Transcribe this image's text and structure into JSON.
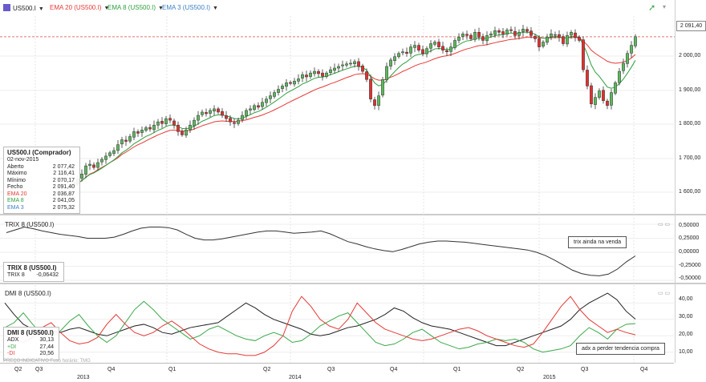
{
  "toolbar": {
    "symbol": "US500.I",
    "ema20": "EMA 20 (US500.I)",
    "ema8": "EMA 8 (US500.I)",
    "ema3": "EMA 3 (US500.I)"
  },
  "colors": {
    "bull": "#5cb85c",
    "bear": "#e03030",
    "ema20": "#e53935",
    "ema8": "#2e9e3e",
    "trix": "#333333",
    "adx": "#222222",
    "plus_di": "#3aa84a",
    "minus_di": "#e53935"
  },
  "price_panel": {
    "current_price": "2 091,40",
    "y_labels": [
      "2 000,00",
      "1 900,00",
      "1 800,00",
      "1 700,00",
      "1 600,00"
    ],
    "legend": {
      "title": "US500.I (Comprador)",
      "date": "02-nov-2015",
      "rows": [
        {
          "k": "Aberto",
          "v": "2 077,42"
        },
        {
          "k": "Máximo",
          "v": "2 116,41"
        },
        {
          "k": "Mínimo",
          "v": "2 070,17"
        },
        {
          "k": "Fecho",
          "v": "2 091,40"
        },
        {
          "k": "EMA 20",
          "v": "2 036,87"
        },
        {
          "k": "EMA 8",
          "v": "2 041,05"
        },
        {
          "k": "EMA 3",
          "v": "2 075,32"
        }
      ]
    }
  },
  "trix_panel": {
    "title": "TRIX 8 (US500.I)",
    "y_labels": [
      "0,50000",
      "0,25000",
      "0,00000",
      "-0,25000",
      "-0,50000"
    ],
    "legend_title": "TRIX 8 (US500.I)",
    "legend_key": "TRIX 8",
    "legend_value": "-0,06432",
    "note": "trix ainda na venda"
  },
  "dmi_panel": {
    "title": "DMI 8 (US500.I)",
    "y_labels": [
      "40,00",
      "30,00",
      "20,00",
      "10,00"
    ],
    "legend_title": "DMI 8 (US500.I)",
    "rows": [
      {
        "k": "ADX",
        "v": "30,13"
      },
      {
        "k": "+DI",
        "v": "27,44"
      },
      {
        "k": "-DI",
        "v": "20,56"
      }
    ],
    "note": "adx a perder tendencia compra"
  },
  "watermark": "PREÇO INDICATIVO   Fuso horário: TMG",
  "x_axis": {
    "quarters": [
      "Q2",
      "Q3",
      "Q4",
      "Q1",
      "Q2",
      "Q3",
      "Q4",
      "Q1",
      "Q2",
      "Q3",
      "Q4"
    ],
    "years": [
      "2013",
      "2014",
      "2015"
    ]
  },
  "chart_data": [
    {
      "type": "candlestick",
      "title": "US500.I",
      "ylim": [
        1560,
        2150
      ],
      "closes": [
        1640,
        1655,
        1670,
        1695,
        1700,
        1690,
        1705,
        1715,
        1725,
        1735,
        1742,
        1760,
        1775,
        1770,
        1785,
        1800,
        1795,
        1805,
        1812,
        1808,
        1820,
        1830,
        1825,
        1840,
        1835,
        1820,
        1800,
        1790,
        1805,
        1820,
        1835,
        1850,
        1860,
        1855,
        1865,
        1870,
        1860,
        1850,
        1840,
        1830,
        1825,
        1835,
        1850,
        1865,
        1870,
        1880,
        1875,
        1890,
        1900,
        1910,
        1920,
        1930,
        1940,
        1950,
        1948,
        1955,
        1962,
        1975,
        1968,
        1980,
        1985,
        1978,
        1970,
        1980,
        1990,
        1995,
        2000,
        2005,
        2008,
        2010,
        2015,
        2000,
        1985,
        1960,
        1900,
        1880,
        1910,
        1960,
        2000,
        2020,
        2030,
        2040,
        2045,
        2040,
        2060,
        2065,
        2050,
        2040,
        2055,
        2070,
        2075,
        2060,
        2050,
        2045,
        2060,
        2080,
        2090,
        2100,
        2095,
        2085,
        2105,
        2090,
        2080,
        2095,
        2100,
        2110,
        2105,
        2100,
        2112,
        2110,
        2095,
        2105,
        2115,
        2108,
        2095,
        2085,
        2060,
        2075,
        2090,
        2100,
        2098,
        2090,
        2070,
        2095,
        2105,
        2090,
        2080,
        1990,
        1940,
        1885,
        1905,
        1925,
        1895,
        1880,
        1920,
        1950,
        1985,
        2010,
        2040,
        2065,
        2091.4
      ],
      "ema20": [
        1630,
        1640,
        1650,
        1660,
        1670,
        1675,
        1683,
        1690,
        1697,
        1705,
        1712,
        1720,
        1730,
        1737,
        1745,
        1753,
        1760,
        1765,
        1772,
        1778,
        1784,
        1790,
        1795,
        1800,
        1804,
        1805,
        1803,
        1801,
        1802,
        1804,
        1808,
        1813,
        1818,
        1822,
        1826,
        1830,
        1832,
        1833,
        1832,
        1832,
        1831,
        1832,
        1834,
        1836,
        1840,
        1844,
        1847,
        1851,
        1856,
        1861,
        1867,
        1873,
        1879,
        1886,
        1892,
        1898,
        1904,
        1910,
        1916,
        1922,
        1928,
        1933,
        1937,
        1942,
        1947,
        1951,
        1956,
        1961,
        1966,
        1970,
        1975,
        1977,
        1978,
        1976,
        1970,
        1962,
        1958,
        1958,
        1962,
        1967,
        1972,
        1978,
        1985,
        1990,
        1996,
        2002,
        2007,
        2010,
        2014,
        2019,
        2024,
        2028,
        2031,
        2033,
        2036,
        2040,
        2045,
        2050,
        2054,
        2057,
        2061,
        2064,
        2065,
        2067,
        2070,
        2073,
        2076,
        2078,
        2081,
        2083,
        2084,
        2086,
        2088,
        2090,
        2090,
        2090,
        2088,
        2087,
        2087,
        2088,
        2089,
        2089,
        2088,
        2088,
        2089,
        2089,
        2088,
        2078,
        2066,
        2050,
        2040,
        2032,
        2024,
        2016,
        2012,
        2010,
        2011,
        2014,
        2018,
        2026,
        2036.87
      ]
    },
    {
      "type": "line",
      "title": "TRIX 8 (US500.I)",
      "ylim": [
        -0.5,
        0.5
      ],
      "series": [
        {
          "name": "TRIX 8",
          "values": [
            0.35,
            0.4,
            0.45,
            0.42,
            0.38,
            0.35,
            0.32,
            0.3,
            0.28,
            0.25,
            0.25,
            0.25,
            0.27,
            0.32,
            0.38,
            0.43,
            0.45,
            0.45,
            0.44,
            0.4,
            0.32,
            0.25,
            0.22,
            0.22,
            0.24,
            0.27,
            0.3,
            0.33,
            0.36,
            0.38,
            0.38,
            0.36,
            0.34,
            0.35,
            0.36,
            0.38,
            0.33,
            0.26,
            0.19,
            0.15,
            0.1,
            0.06,
            0.03,
            0.01,
            0.05,
            0.1,
            0.15,
            0.18,
            0.2,
            0.2,
            0.19,
            0.18,
            0.16,
            0.14,
            0.12,
            0.1,
            0.08,
            0.06,
            0.04,
            0.0,
            -0.06,
            -0.14,
            -0.23,
            -0.32,
            -0.38,
            -0.41,
            -0.42,
            -0.39,
            -0.3,
            -0.17,
            -0.06432
          ]
        }
      ]
    },
    {
      "type": "line",
      "title": "DMI 8 (US500.I)",
      "ylim": [
        5,
        47
      ],
      "series": [
        {
          "name": "ADX",
          "values": [
            40,
            33,
            27,
            24,
            22,
            23,
            22,
            24,
            25,
            23,
            21,
            20,
            22,
            24,
            26,
            27,
            25,
            22,
            21,
            23,
            25,
            26,
            27,
            28,
            32,
            36,
            40,
            37,
            33,
            30,
            28,
            26,
            24,
            21,
            20,
            21,
            23,
            25,
            26,
            28,
            30,
            33,
            37,
            35,
            31,
            28,
            26,
            25,
            24,
            22,
            20,
            18,
            16,
            14,
            14,
            16,
            18,
            20,
            22,
            24,
            26,
            30,
            36,
            40,
            43,
            46,
            42,
            35,
            30.13
          ]
        },
        {
          "name": "+DI",
          "values": [
            25,
            28,
            34,
            27,
            21,
            19,
            23,
            29,
            33,
            26,
            20,
            16,
            20,
            28,
            36,
            41,
            36,
            30,
            26,
            22,
            18,
            20,
            24,
            26,
            23,
            20,
            18,
            17,
            20,
            22,
            20,
            16,
            17,
            21,
            26,
            29,
            32,
            34,
            28,
            22,
            16,
            14,
            15,
            18,
            22,
            24,
            20,
            16,
            14,
            12,
            13,
            15,
            16,
            18,
            17,
            18,
            16,
            12,
            10,
            11,
            12,
            14,
            20,
            25,
            22,
            18,
            24,
            27,
            27.44
          ]
        },
        {
          "name": "-DI",
          "values": [
            20,
            18,
            16,
            19,
            25,
            28,
            22,
            17,
            15,
            16,
            19,
            27,
            33,
            27,
            22,
            20,
            22,
            26,
            29,
            25,
            20,
            15,
            12,
            10,
            9,
            9,
            8,
            8,
            10,
            14,
            20,
            35,
            44,
            38,
            30,
            26,
            24,
            30,
            40,
            34,
            28,
            24,
            22,
            20,
            18,
            17,
            18,
            20,
            22,
            24,
            25,
            23,
            20,
            18,
            16,
            14,
            13,
            15,
            22,
            30,
            38,
            44,
            36,
            30,
            26,
            22,
            24,
            22,
            20.56
          ]
        }
      ]
    }
  ]
}
